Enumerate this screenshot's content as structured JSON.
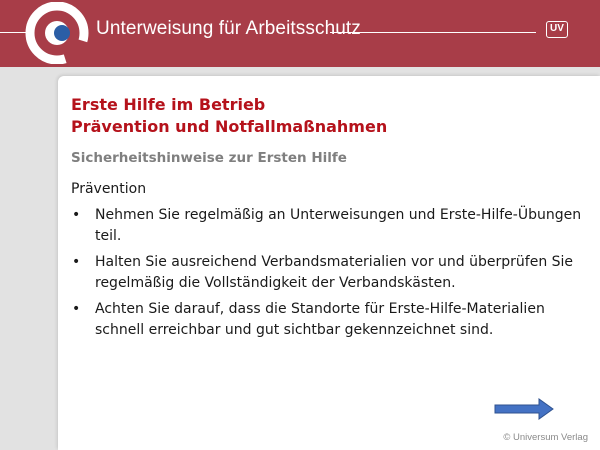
{
  "header": {
    "title": "Unterweisung für Arbeitsschutz",
    "badge": "UV",
    "logo_icon": "universum-logo-icon",
    "colors": {
      "brand": "#a83d48",
      "logo_blue": "#2b5ea6"
    }
  },
  "slide": {
    "title_line1": "Erste Hilfe im Betrieb",
    "title_line2": "Prävention und Notfallmaßnahmen",
    "subtitle": "Sicherheitshinweise zur Ersten Hilfe",
    "section": "Prävention",
    "bullet_symbol": "•",
    "bullets": [
      "Nehmen Sie regelmäßig an Unterweisungen und Erste-Hilfe-Übungen teil.",
      "Halten Sie ausreichend Verbandsmaterialien vor und überprüfen Sie regelmäßig die Vollständigkeit der Verbandskästen.",
      "Achten Sie darauf, dass die Standorte für Erste-Hilfe-Materialien schnell erreichbar und gut sichtbar gekennzeichnet sind."
    ],
    "next_icon": "arrow-right-icon",
    "copyright": "© Universum Verlag",
    "colors": {
      "title": "#b5121b",
      "subtitle": "#7f7f7f",
      "arrow": "#4472c4"
    }
  }
}
